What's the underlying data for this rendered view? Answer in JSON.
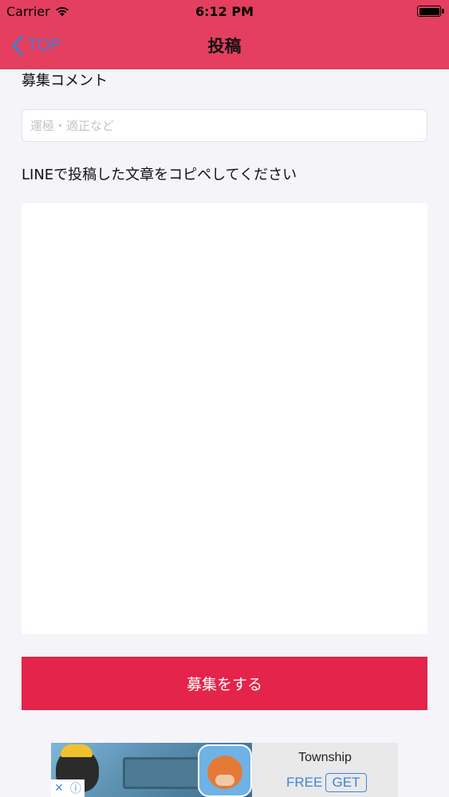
{
  "status_bar": {
    "carrier": "Carrier",
    "time": "6:12 PM"
  },
  "nav": {
    "back_label": "TOP",
    "title": "投稿"
  },
  "form": {
    "comment_label": "募集コメント",
    "comment_placeholder": "運極・適正など",
    "comment_value": "",
    "paste_label": "LINEで投稿した文章をコピペしてください",
    "paste_value": "",
    "submit_label": "募集をする"
  },
  "ad": {
    "app_name": "Township",
    "price": "FREE",
    "get_label": "GET",
    "close_glyph": "✕",
    "info_glyph": "ⓘ"
  },
  "colors": {
    "header": "#e43f5f",
    "accent_blue": "#4a7bd0",
    "submit": "#e4244a",
    "background": "#f4f4f9"
  }
}
